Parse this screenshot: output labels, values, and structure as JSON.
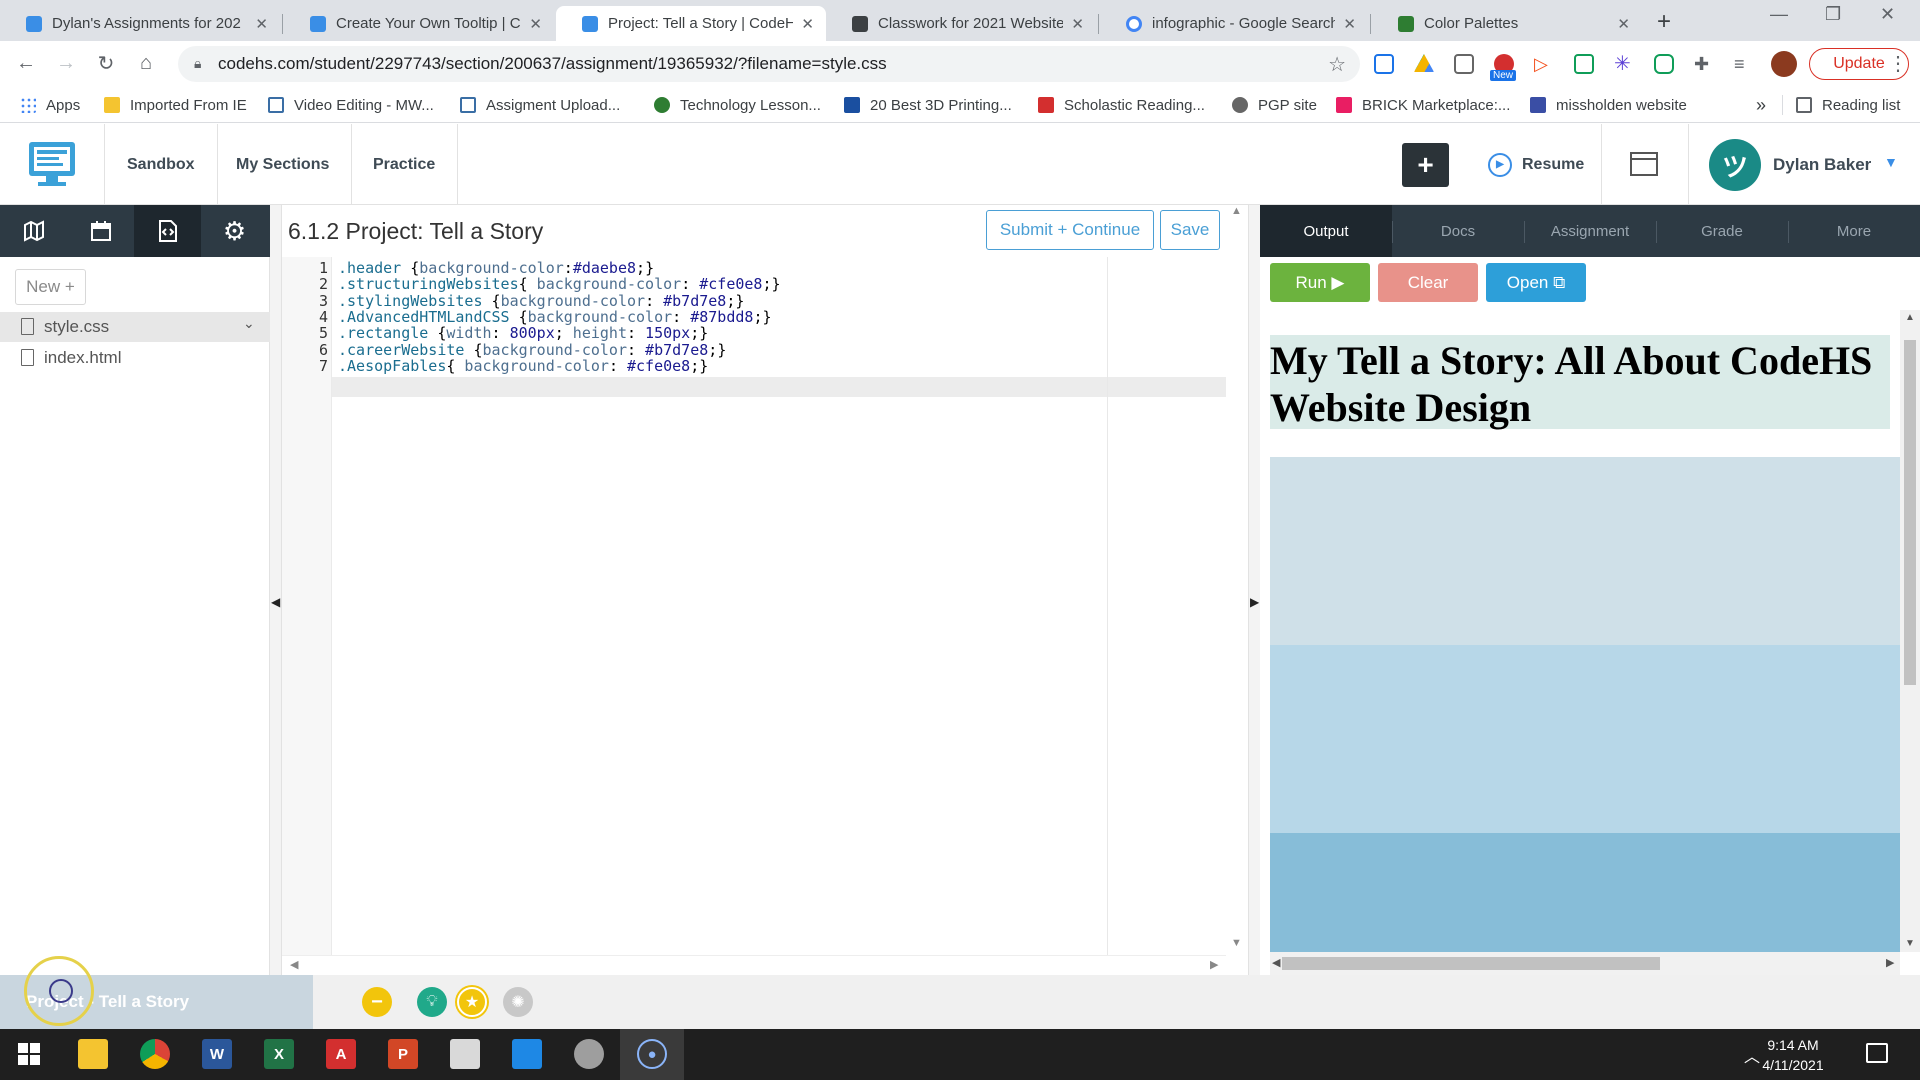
{
  "browser": {
    "tabs": [
      {
        "title": "Dylan's Assignments for 202",
        "fav_color": "#3a8ee6"
      },
      {
        "title": "Create Your Own Tooltip | Co",
        "fav_color": "#3a8ee6"
      },
      {
        "title": "Project: Tell a Story | CodeHS",
        "fav_color": "#3a8ee6"
      },
      {
        "title": "Classwork for 2021 Website",
        "fav_color": "#3c4043"
      },
      {
        "title": "infographic - Google Search",
        "fav_color": "#4285f4"
      },
      {
        "title": "Color Palettes",
        "fav_color": "#2e7d32"
      }
    ],
    "url": "codehs.com/student/2297743/section/200637/assignment/19365932/?filename=style.css",
    "update_label": "Update",
    "bookmarks": [
      {
        "label": "Apps",
        "color": "#4285f4"
      },
      {
        "label": "Imported From IE",
        "color": "#f4c430"
      },
      {
        "label": "Video Editing - MW...",
        "color": "#3a6ea5"
      },
      {
        "label": "Assigment Upload...",
        "color": "#3a6ea5"
      },
      {
        "label": "Technology Lesson...",
        "color": "#2e7d32"
      },
      {
        "label": "20 Best 3D Printing...",
        "color": "#1a4fa0"
      },
      {
        "label": "Scholastic Reading...",
        "color": "#d32f2f"
      },
      {
        "label": "PGP site",
        "color": "#666666"
      },
      {
        "label": "BRICK Marketplace:...",
        "color": "#e91e63"
      },
      {
        "label": "missholden website",
        "color": "#3a4ea5"
      }
    ],
    "more_bookmarks": "»",
    "reading_list": "Reading list",
    "ext_badge": "New"
  },
  "codehs": {
    "nav": [
      "Sandbox",
      "My Sections",
      "Practice"
    ],
    "plus_label": "+",
    "resume_label": "Resume",
    "user_name": "Dylan Baker"
  },
  "sidebar": {
    "new_label": "New +",
    "files": [
      "style.css",
      "index.html"
    ]
  },
  "editor": {
    "title": "6.1.2 Project: Tell a Story",
    "submit_label": "Submit + Continue",
    "save_label": "Save",
    "line_numbers": [
      "1",
      "2",
      "3",
      "4",
      "5",
      "6",
      "7"
    ],
    "lines": [
      ".header {background-color:#daebe8;}",
      ".structuringWebsites{ background-color: #cfe0e8;}",
      ".stylingWebsites {background-color: #b7d7e8;}",
      ".AdvancedHTMLandCSS {background-color: #87bdd8;}",
      ".rectangle {width: 800px; height: 150px;}",
      ".careerWebsite {background-color: #b7d7e8;}",
      ".AesopFables{ background-color: #cfe0e8;}"
    ]
  },
  "right_panel": {
    "tabs": [
      "Output",
      "Docs",
      "Assignment",
      "Grade",
      "More"
    ],
    "run_label": "Run ▶",
    "clear_label": "Clear",
    "open_label": "Open ⧉",
    "output_heading": "My Tell a Story: All About CodeHS Website Design",
    "band_colors": [
      "#cfe0e8",
      "#b7d7e8",
      "#87bdd8"
    ]
  },
  "bottom": {
    "project_label": "Project - Tell a Story"
  },
  "taskbar": {
    "time": "9:14 AM",
    "date": "4/11/2021"
  },
  "colors": {
    "codehs_dark": "#2d3a44",
    "run_green": "#6cb33e",
    "clear_red": "#e8928a",
    "open_blue": "#2d9fd9",
    "header_bg": "#daebe8"
  }
}
